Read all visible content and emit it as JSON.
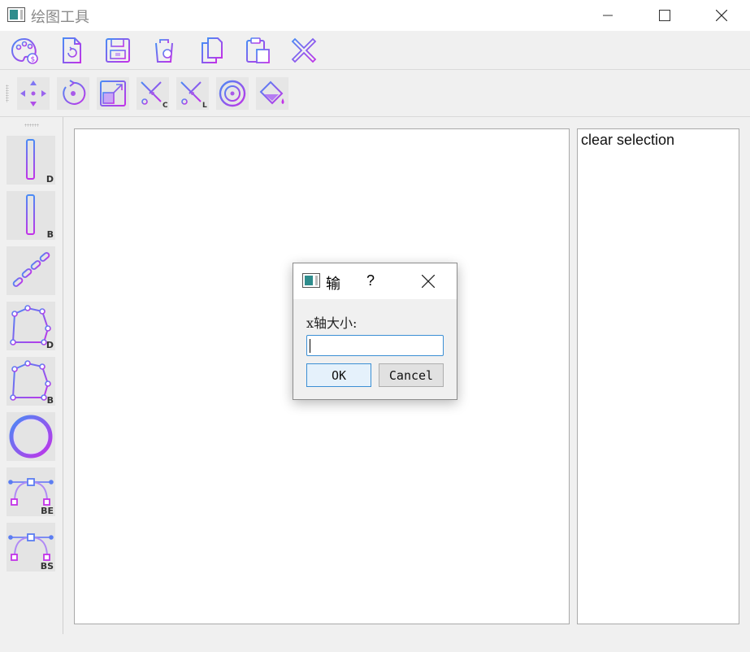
{
  "window": {
    "title": "绘图工具",
    "minimize_icon": "minimize-icon",
    "maximize_icon": "maximize-icon",
    "close_icon": "close-icon"
  },
  "toolbar1": {
    "items": [
      {
        "name": "palette-icon"
      },
      {
        "name": "new-file-icon"
      },
      {
        "name": "save-icon"
      },
      {
        "name": "trash-icon"
      },
      {
        "name": "copy-icon"
      },
      {
        "name": "paste-icon"
      },
      {
        "name": "close-cross-icon"
      }
    ]
  },
  "toolbar2": {
    "items": [
      {
        "name": "move-icon"
      },
      {
        "name": "rotate-icon"
      },
      {
        "name": "scale-icon"
      },
      {
        "name": "clip-cohen-icon",
        "tag": "C"
      },
      {
        "name": "clip-liang-icon",
        "tag": "L"
      },
      {
        "name": "circle-target-icon"
      },
      {
        "name": "fill-bucket-icon"
      }
    ]
  },
  "left_tools": [
    {
      "name": "line-dda-icon",
      "tag": "D"
    },
    {
      "name": "line-bresenham-icon",
      "tag": "B"
    },
    {
      "name": "chain-line-icon",
      "tag": ""
    },
    {
      "name": "polygon-dda-icon",
      "tag": "D"
    },
    {
      "name": "polygon-bresenham-icon",
      "tag": "B"
    },
    {
      "name": "ellipse-icon",
      "tag": ""
    },
    {
      "name": "curve-bezier-icon",
      "tag": "BE"
    },
    {
      "name": "curve-bspline-icon",
      "tag": "BS"
    }
  ],
  "side_list": {
    "items": [
      "clear selection"
    ]
  },
  "dialog": {
    "title": "输",
    "help": "?",
    "label": "x轴大小:",
    "input_value": "",
    "ok_label": "OK",
    "cancel_label": "Cancel"
  },
  "colors": {
    "accent": "#3b8fd4",
    "icon_purple": "#a23cf0",
    "icon_blue": "#4a8bf5"
  }
}
